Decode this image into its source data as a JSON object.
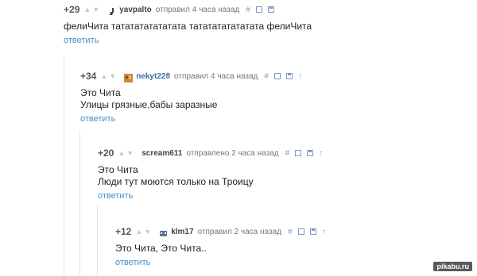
{
  "comments": [
    {
      "rating": "+29",
      "username": "yavpalto",
      "meta": "отправил 4 часа назад",
      "lines": [
        "фелиЧита тататататататата тататататататата фелиЧита"
      ],
      "reply": "ответить",
      "icons": [
        "hash-icon",
        "minus-box-icon",
        "save-icon"
      ]
    },
    {
      "rating": "+34",
      "username": "nekyt228",
      "meta": "отправил 4 часа назад",
      "lines": [
        "Это Чита",
        "Улицы грязные,бабы заразные"
      ],
      "reply": "ответить",
      "icons": [
        "hash-icon",
        "minus-box-icon",
        "save-icon",
        "up-arrow-icon"
      ]
    },
    {
      "rating": "+20",
      "username": "scream611",
      "meta": "отправлено 2 часа назад",
      "lines": [
        "Это Чита",
        "Люди тут моются только на Троицу"
      ],
      "reply": "ответить",
      "icons": [
        "hash-icon",
        "minus-box-icon",
        "save-icon",
        "up-arrow-icon"
      ]
    },
    {
      "rating": "+12",
      "username": "klm17",
      "meta": "отправил 2 часа назад",
      "lines": [
        "Это Чита, Это Чита.."
      ],
      "reply": "ответить",
      "icons": [
        "hash-icon",
        "minus-box-icon",
        "save-icon",
        "up-arrow-icon"
      ]
    }
  ],
  "glyphs": {
    "hash": "#",
    "up": "↑",
    "vote_up": "▲",
    "vote_down": "▼"
  },
  "colors": {
    "link": "#4a8ec2",
    "username_highlight": "#3a6fa8",
    "tool": "#7c98c4"
  },
  "watermark": "pikabu.ru"
}
